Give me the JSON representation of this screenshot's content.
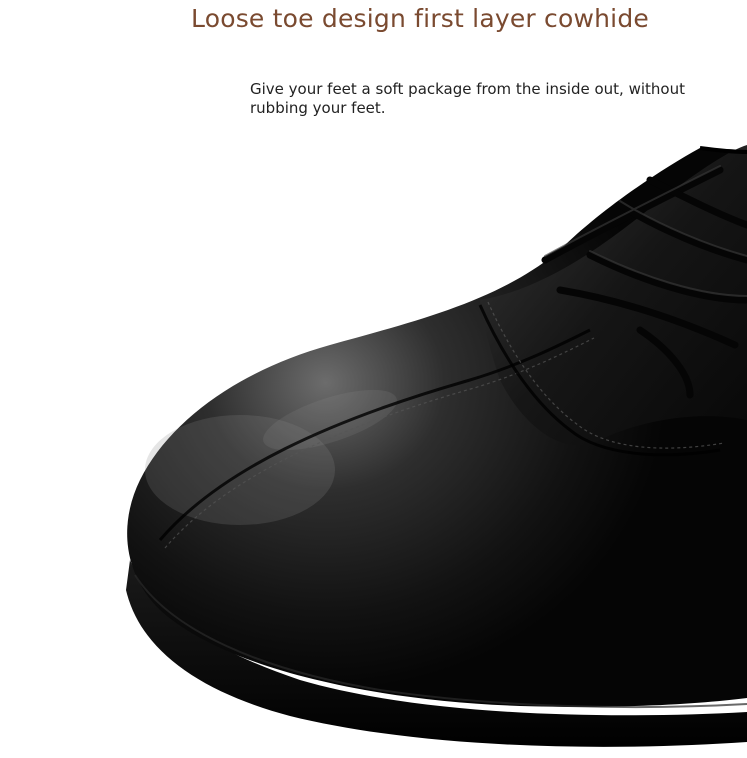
{
  "headline": "Loose toe design first layer cowhide",
  "description": "Give your feet a soft package from the inside out, without rubbing your feet.",
  "image": {
    "subject": "shoe-photo",
    "colors": {
      "text_heading": "#7a4a30",
      "text_body": "#222222",
      "leather": "#101010",
      "background": "#ffffff"
    }
  }
}
